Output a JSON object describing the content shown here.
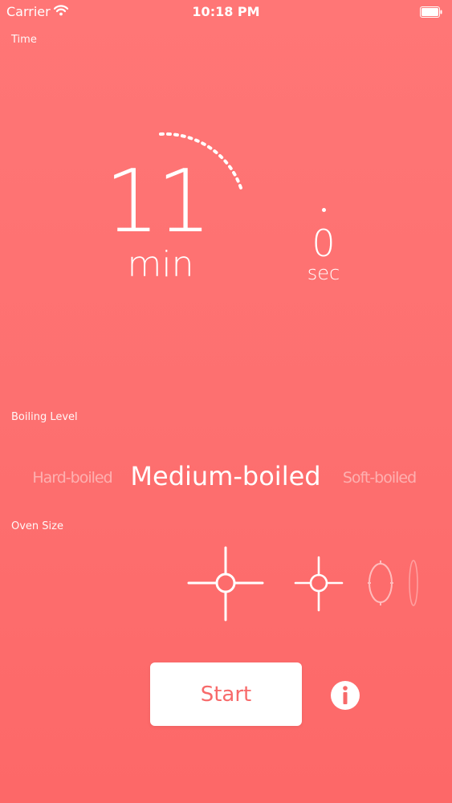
{
  "status_bar": {
    "carrier": "Carrier",
    "time": "10:18 PM",
    "wifi_icon": "wifi-icon",
    "battery_icon": "battery-full-icon"
  },
  "sections": {
    "time_label": "Time",
    "boiling_level_label": "Boiling Level",
    "oven_size_label": "Oven Size"
  },
  "timer": {
    "minutes": "11",
    "minutes_unit": "min",
    "seconds": "0",
    "seconds_unit": "sec"
  },
  "boiling_level": {
    "options": [
      "Hard-boiled",
      "Medium-boiled",
      "Soft-boiled"
    ],
    "selected": "Medium-boiled"
  },
  "oven_size": {
    "icons": [
      "burner-size-large-icon",
      "burner-size-medium-icon",
      "burner-size-small-icon",
      "burner-size-smallest-icon"
    ]
  },
  "actions": {
    "start_label": "Start",
    "info_icon": "info-icon"
  },
  "colors": {
    "background_top": "#ff7676",
    "background_bottom": "#fd6868",
    "button_background": "#ffffff",
    "button_text": "#f76a6a",
    "foreground": "#ffffff"
  }
}
